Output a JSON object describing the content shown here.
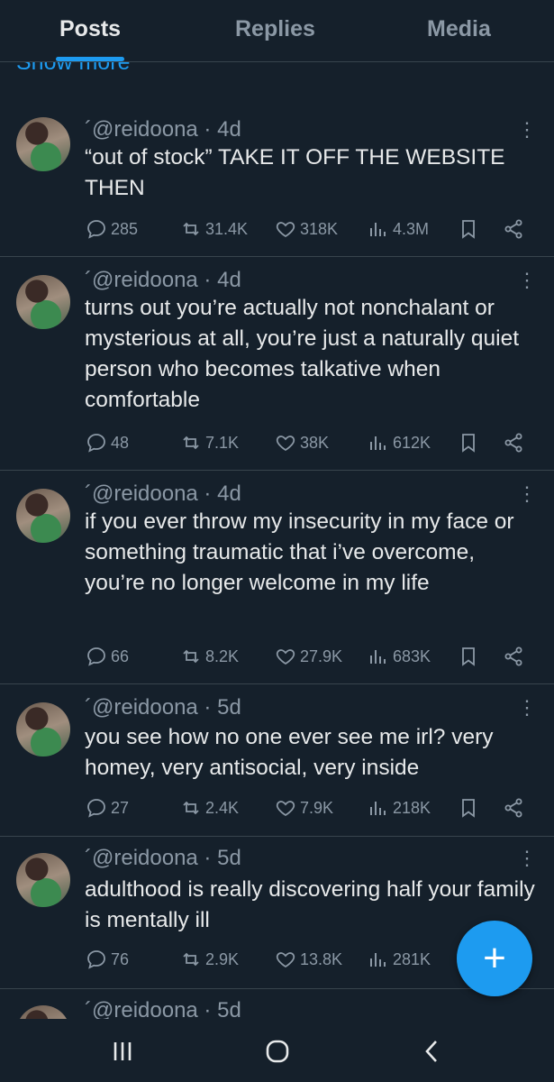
{
  "tabs": [
    {
      "label": "Posts",
      "active": true
    },
    {
      "label": "Replies",
      "active": false
    },
    {
      "label": "Media",
      "active": false
    }
  ],
  "show_more": "Show more",
  "posts": [
    {
      "handle": "´@reidoona",
      "time": "4d",
      "text": "“out of stock” TAKE IT OFF THE WEBSITE THEN",
      "replies": "285",
      "reposts": "31.4K",
      "likes": "318K",
      "views": "4.3M"
    },
    {
      "handle": "´@reidoona",
      "time": "4d",
      "text": "turns out you’re actually not nonchalant or mysterious at all, you’re just a naturally quiet person who becomes talkative when comfortable",
      "replies": "48",
      "reposts": "7.1K",
      "likes": "38K",
      "views": "612K"
    },
    {
      "handle": "´@reidoona",
      "time": "4d",
      "text": "if you ever throw my insecurity in my face or something traumatic that i’ve overcome, you’re no longer welcome in my life",
      "replies": "66",
      "reposts": "8.2K",
      "likes": "27.9K",
      "views": "683K"
    },
    {
      "handle": "´@reidoona",
      "time": "5d",
      "text": "you see how no one ever see me irl? very homey, very antisocial, very inside",
      "replies": "27",
      "reposts": "2.4K",
      "likes": "7.9K",
      "views": "218K"
    },
    {
      "handle": "´@reidoona",
      "time": "5d",
      "text": "adulthood is really discovering half your family is mentally ill",
      "replies": "76",
      "reposts": "2.9K",
      "likes": "13.8K",
      "views": "281K"
    },
    {
      "handle": "´@reidoona",
      "time": "5d"
    }
  ],
  "fab": {
    "label": "+"
  },
  "colors": {
    "background": "#15202b",
    "accent": "#1d9bf0",
    "muted": "#8b98a5",
    "divider": "#38444d"
  }
}
